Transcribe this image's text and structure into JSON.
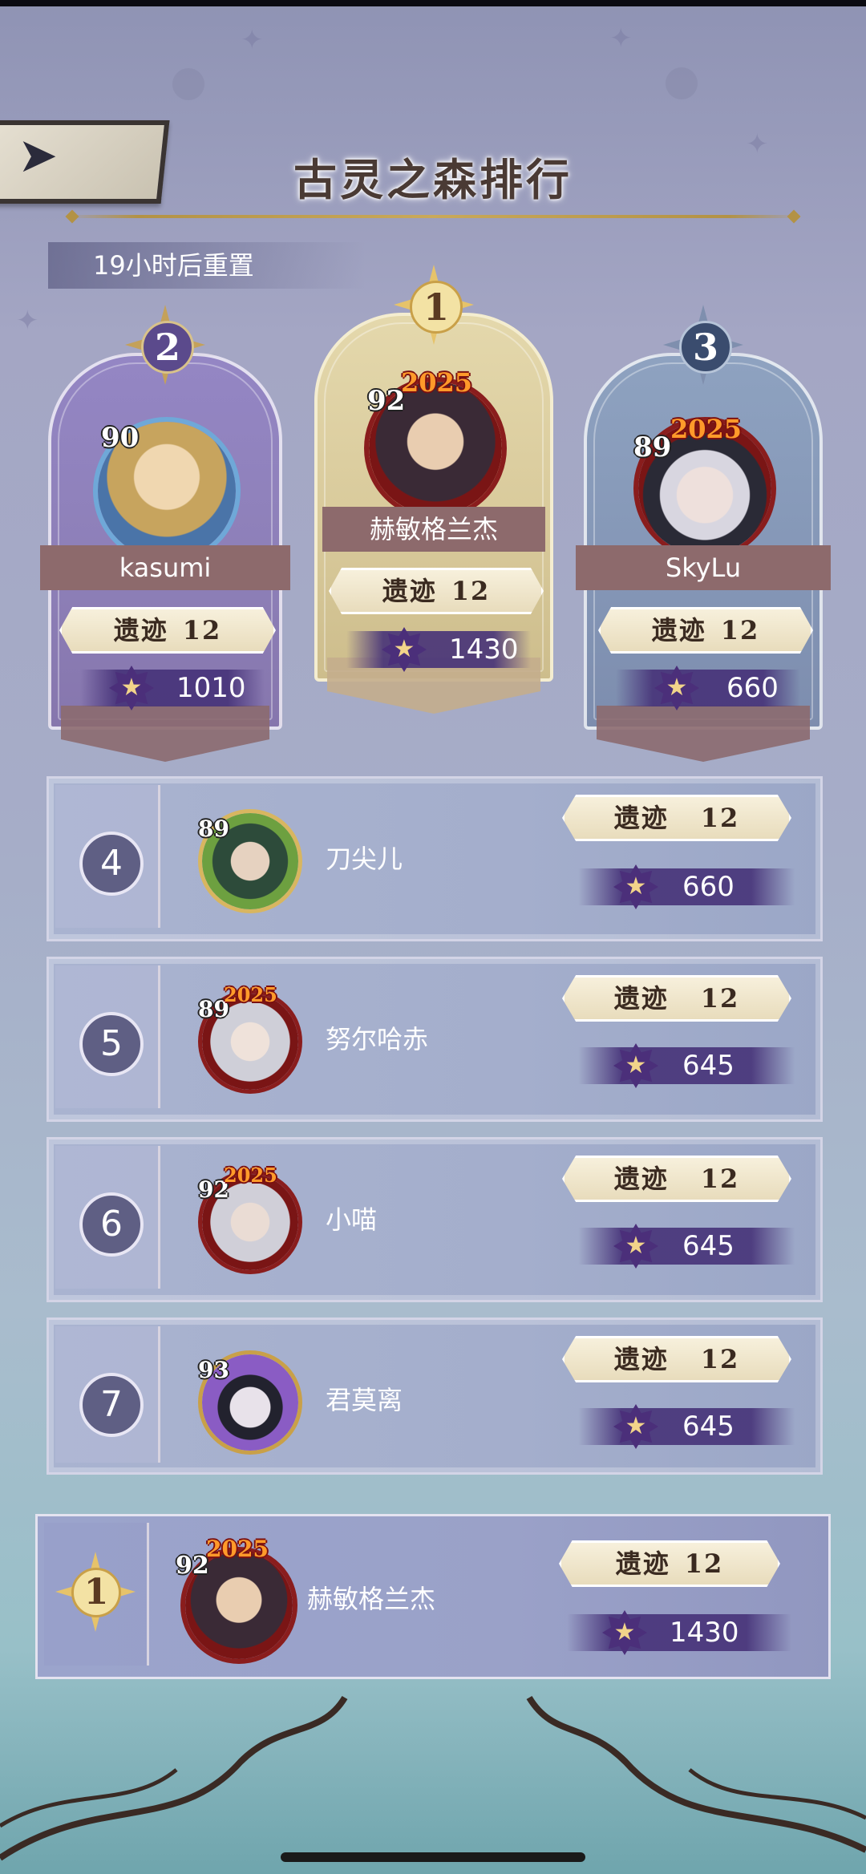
{
  "header": {
    "title": "古灵之森排行",
    "reset_text": "19小时后重置"
  },
  "podium": [
    {
      "rank": "2",
      "level": "90",
      "name": "kasumi",
      "relic_label": "遗迹",
      "relic_level": "12",
      "score": "1010",
      "has_2025_badge": false
    },
    {
      "rank": "1",
      "level": "92",
      "name": "赫敏格兰杰",
      "relic_label": "遗迹",
      "relic_level": "12",
      "score": "1430",
      "has_2025_badge": true,
      "badge_text": "2025"
    },
    {
      "rank": "3",
      "level": "89",
      "name": "SkyLu",
      "relic_label": "遗迹",
      "relic_level": "12",
      "score": "660",
      "has_2025_badge": true,
      "badge_text": "2025"
    }
  ],
  "list": [
    {
      "rank": "4",
      "level": "89",
      "name": "刀尖儿",
      "relic_label": "遗迹",
      "relic_level": "12",
      "score": "660",
      "badge_text": ""
    },
    {
      "rank": "5",
      "level": "89",
      "name": "努尔哈赤",
      "relic_label": "遗迹",
      "relic_level": "12",
      "score": "645",
      "badge_text": "2025"
    },
    {
      "rank": "6",
      "level": "92",
      "name": "小喵",
      "relic_label": "遗迹",
      "relic_level": "12",
      "score": "645",
      "badge_text": "2025"
    },
    {
      "rank": "7",
      "level": "93",
      "name": "君莫离",
      "relic_label": "遗迹",
      "relic_level": "12",
      "score": "645",
      "badge_text": ""
    }
  ],
  "my_rank": {
    "rank": "1",
    "level": "92",
    "badge_text": "2025",
    "name": "赫敏格兰杰",
    "relic_label": "遗迹",
    "relic_level": "12",
    "score": "1430"
  },
  "icons": {
    "back": "back-arrow-icon",
    "score": "star-emblem-icon"
  },
  "colors": {
    "accent_gold": "#c9a048",
    "score_purple": "#4b2f7a",
    "banner_rose": "#8d6a6c"
  }
}
